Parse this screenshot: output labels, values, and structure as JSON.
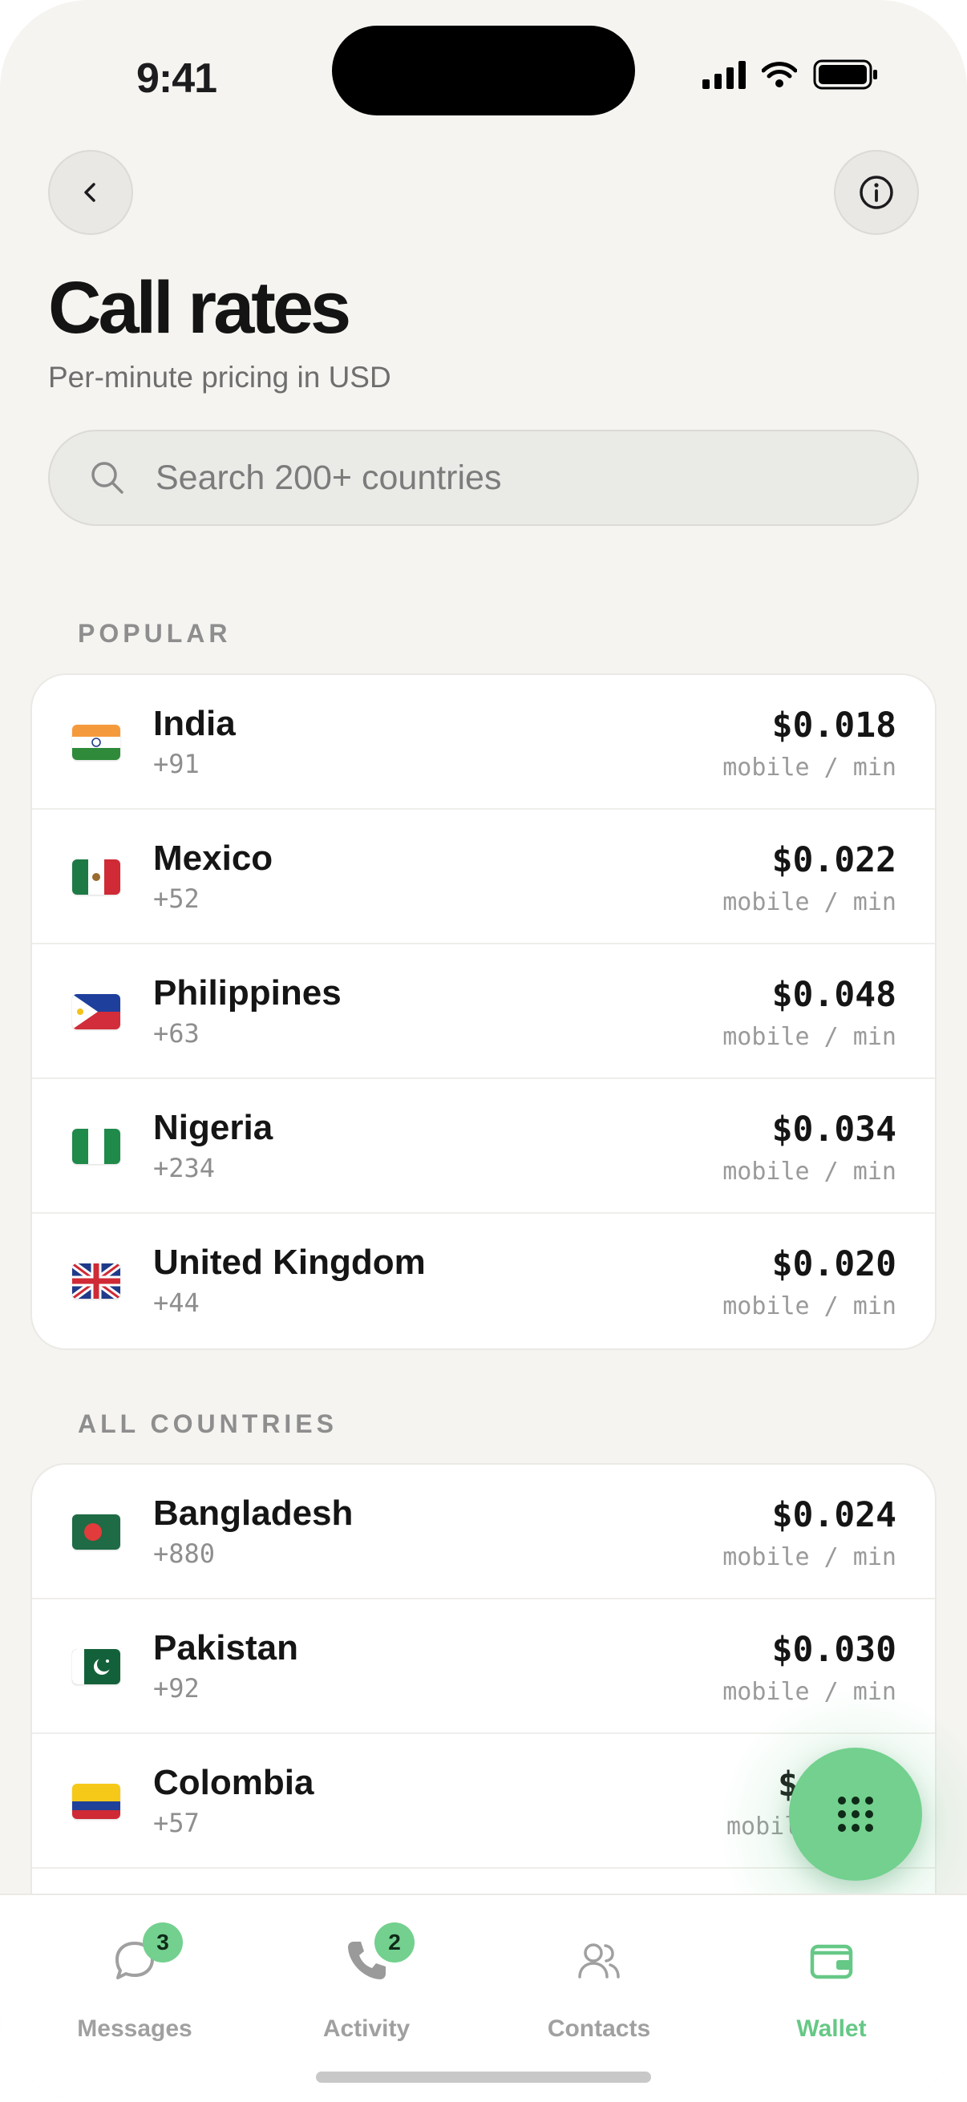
{
  "status_bar": {
    "time": "9:41"
  },
  "header": {
    "title": "Call rates",
    "subtitle": "Per-minute pricing in USD"
  },
  "search": {
    "placeholder": "Search 200+ countries"
  },
  "sections": {
    "popular": {
      "label": "POPULAR",
      "rows": [
        {
          "name": "India",
          "code": "+91",
          "rate": "$0.018",
          "unit": "mobile / min"
        },
        {
          "name": "Mexico",
          "code": "+52",
          "rate": "$0.022",
          "unit": "mobile / min"
        },
        {
          "name": "Philippines",
          "code": "+63",
          "rate": "$0.048",
          "unit": "mobile / min"
        },
        {
          "name": "Nigeria",
          "code": "+234",
          "rate": "$0.034",
          "unit": "mobile / min"
        },
        {
          "name": "United Kingdom",
          "code": "+44",
          "rate": "$0.020",
          "unit": "mobile / min"
        }
      ]
    },
    "all": {
      "label": "ALL COUNTRIES",
      "rows": [
        {
          "name": "Bangladesh",
          "code": "+880",
          "rate": "$0.024",
          "unit": "mobile / min"
        },
        {
          "name": "Pakistan",
          "code": "+92",
          "rate": "$0.030",
          "unit": "mobile / min"
        },
        {
          "name": "Colombia",
          "code": "+57",
          "rate": "$",
          "unit": "mobil"
        }
      ]
    }
  },
  "tabs": [
    {
      "label": "Messages",
      "badge": "3",
      "icon": "chat-bubble-icon"
    },
    {
      "label": "Activity",
      "badge": "2",
      "icon": "phone-icon"
    },
    {
      "label": "Contacts",
      "icon": "contacts-icon"
    },
    {
      "label": "Wallet",
      "icon": "wallet-icon",
      "active": true
    }
  ],
  "fab": {
    "icon": "keypad-icon"
  },
  "colors": {
    "accent": "#73d08e",
    "accent_text": "#66c886",
    "background": "#f5f4f1"
  }
}
